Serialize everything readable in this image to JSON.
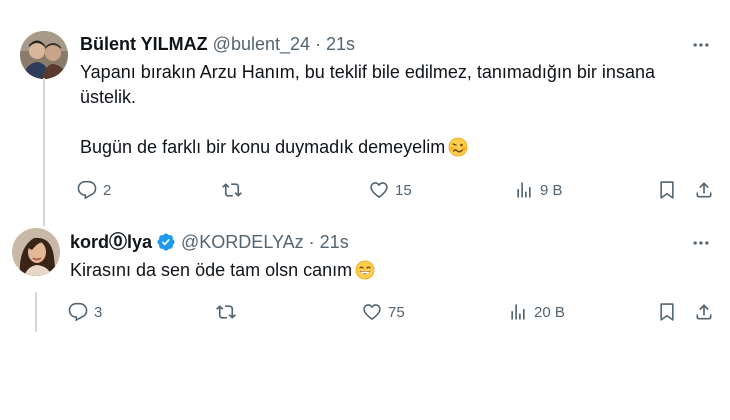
{
  "tweets": [
    {
      "name": "Bülent YILMAZ",
      "handle": "@bulent_24",
      "separator": "·",
      "time": "21s",
      "text_line1": "Yapanı bırakın Arzu Hanım, bu teklif bile edilmez, tanımadığın bir insana",
      "text_line2": "üstelik.",
      "text_line3": "Bugün de farklı bir konu duymadık demeyelim",
      "emoji": "woozy-face-emoji",
      "replies": "2",
      "retweets": "",
      "likes": "15",
      "views": "9 B",
      "avatar": "avatar-two-men-photo"
    },
    {
      "name": "kord⓪lya",
      "handle": "@KORDELYAz",
      "separator": "·",
      "time": "21s",
      "verified": true,
      "text_line1": "Kirasını da sen öde tam olsn canım",
      "emoji": "grinning-smiling-eyes-emoji",
      "replies": "3",
      "retweets": "",
      "likes": "75",
      "views": "20 B",
      "avatar": "avatar-woman-photo"
    }
  ],
  "colors": {
    "text": "#0f1419",
    "secondary": "#536471",
    "verified_blue": "#1d9bf0",
    "thread_line": "#cfd9de"
  },
  "icons": [
    "reply-icon",
    "retweet-icon",
    "like-icon",
    "views-icon",
    "bookmark-icon",
    "share-icon",
    "more-icon"
  ]
}
